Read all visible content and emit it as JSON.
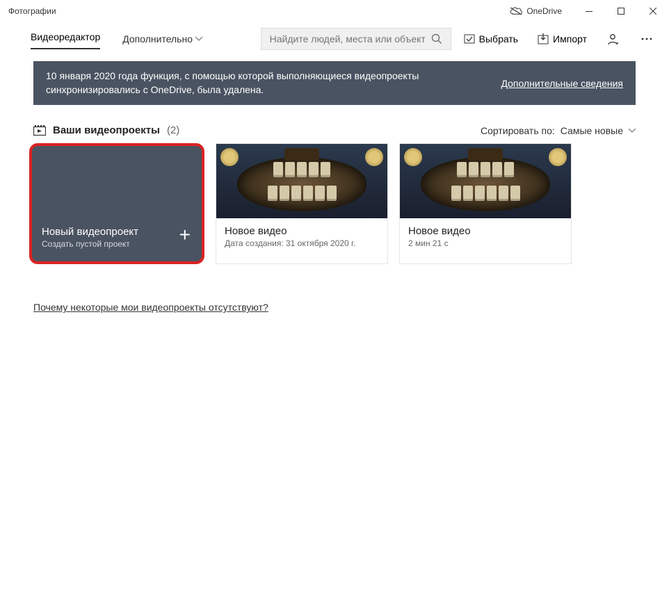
{
  "window": {
    "title": "Фотографии"
  },
  "titlebar": {
    "onedrive": "OneDrive"
  },
  "toolbar": {
    "tab_editor": "Видеоредактор",
    "tab_more": "Дополнительно",
    "search_placeholder": "Найдите людей, места или объект",
    "select_label": "Выбрать",
    "import_label": "Импорт"
  },
  "banner": {
    "text": "10 января 2020 года функция, с помощью которой выполняющиеся видеопроекты синхронизировались с OneDrive, была удалена.",
    "link": "Дополнительные сведения"
  },
  "projects": {
    "header_label": "Ваши видеопроекты",
    "count": "(2)",
    "sort_label": "Сортировать по:",
    "sort_value": "Самые новые",
    "new_card": {
      "title": "Новый видеопроект",
      "subtitle": "Создать пустой проект"
    },
    "items": [
      {
        "title": "Новое видео",
        "meta": "Дата создания: 31 октября 2020 г."
      },
      {
        "title": "Новое видео",
        "meta": "2 мин 21 с"
      }
    ]
  },
  "footer": {
    "missing_link": "Почему некоторые мои видеопроекты отсутствуют?"
  }
}
